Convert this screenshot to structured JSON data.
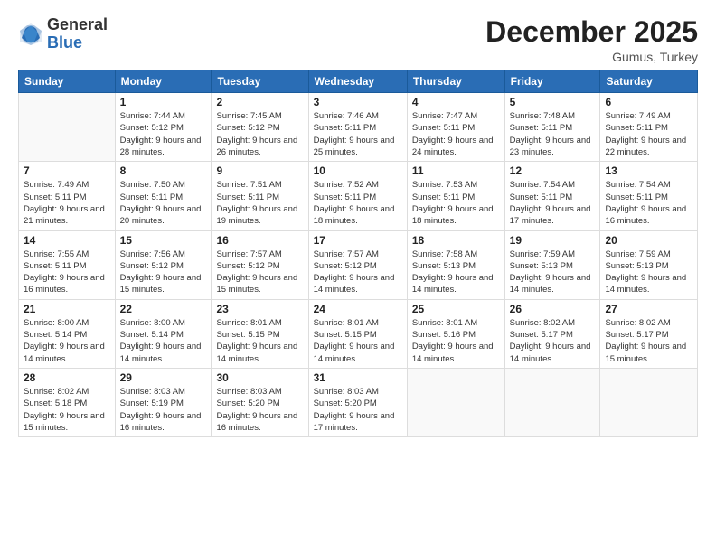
{
  "logo": {
    "general": "General",
    "blue": "Blue"
  },
  "header": {
    "month": "December 2025",
    "location": "Gumus, Turkey"
  },
  "days_of_week": [
    "Sunday",
    "Monday",
    "Tuesday",
    "Wednesday",
    "Thursday",
    "Friday",
    "Saturday"
  ],
  "weeks": [
    [
      {
        "day": "",
        "info": ""
      },
      {
        "day": "1",
        "info": "Sunrise: 7:44 AM\nSunset: 5:12 PM\nDaylight: 9 hours\nand 28 minutes."
      },
      {
        "day": "2",
        "info": "Sunrise: 7:45 AM\nSunset: 5:12 PM\nDaylight: 9 hours\nand 26 minutes."
      },
      {
        "day": "3",
        "info": "Sunrise: 7:46 AM\nSunset: 5:11 PM\nDaylight: 9 hours\nand 25 minutes."
      },
      {
        "day": "4",
        "info": "Sunrise: 7:47 AM\nSunset: 5:11 PM\nDaylight: 9 hours\nand 24 minutes."
      },
      {
        "day": "5",
        "info": "Sunrise: 7:48 AM\nSunset: 5:11 PM\nDaylight: 9 hours\nand 23 minutes."
      },
      {
        "day": "6",
        "info": "Sunrise: 7:49 AM\nSunset: 5:11 PM\nDaylight: 9 hours\nand 22 minutes."
      }
    ],
    [
      {
        "day": "7",
        "info": "Sunrise: 7:49 AM\nSunset: 5:11 PM\nDaylight: 9 hours\nand 21 minutes."
      },
      {
        "day": "8",
        "info": "Sunrise: 7:50 AM\nSunset: 5:11 PM\nDaylight: 9 hours\nand 20 minutes."
      },
      {
        "day": "9",
        "info": "Sunrise: 7:51 AM\nSunset: 5:11 PM\nDaylight: 9 hours\nand 19 minutes."
      },
      {
        "day": "10",
        "info": "Sunrise: 7:52 AM\nSunset: 5:11 PM\nDaylight: 9 hours\nand 18 minutes."
      },
      {
        "day": "11",
        "info": "Sunrise: 7:53 AM\nSunset: 5:11 PM\nDaylight: 9 hours\nand 18 minutes."
      },
      {
        "day": "12",
        "info": "Sunrise: 7:54 AM\nSunset: 5:11 PM\nDaylight: 9 hours\nand 17 minutes."
      },
      {
        "day": "13",
        "info": "Sunrise: 7:54 AM\nSunset: 5:11 PM\nDaylight: 9 hours\nand 16 minutes."
      }
    ],
    [
      {
        "day": "14",
        "info": "Sunrise: 7:55 AM\nSunset: 5:11 PM\nDaylight: 9 hours\nand 16 minutes."
      },
      {
        "day": "15",
        "info": "Sunrise: 7:56 AM\nSunset: 5:12 PM\nDaylight: 9 hours\nand 15 minutes."
      },
      {
        "day": "16",
        "info": "Sunrise: 7:57 AM\nSunset: 5:12 PM\nDaylight: 9 hours\nand 15 minutes."
      },
      {
        "day": "17",
        "info": "Sunrise: 7:57 AM\nSunset: 5:12 PM\nDaylight: 9 hours\nand 14 minutes."
      },
      {
        "day": "18",
        "info": "Sunrise: 7:58 AM\nSunset: 5:13 PM\nDaylight: 9 hours\nand 14 minutes."
      },
      {
        "day": "19",
        "info": "Sunrise: 7:59 AM\nSunset: 5:13 PM\nDaylight: 9 hours\nand 14 minutes."
      },
      {
        "day": "20",
        "info": "Sunrise: 7:59 AM\nSunset: 5:13 PM\nDaylight: 9 hours\nand 14 minutes."
      }
    ],
    [
      {
        "day": "21",
        "info": "Sunrise: 8:00 AM\nSunset: 5:14 PM\nDaylight: 9 hours\nand 14 minutes."
      },
      {
        "day": "22",
        "info": "Sunrise: 8:00 AM\nSunset: 5:14 PM\nDaylight: 9 hours\nand 14 minutes."
      },
      {
        "day": "23",
        "info": "Sunrise: 8:01 AM\nSunset: 5:15 PM\nDaylight: 9 hours\nand 14 minutes."
      },
      {
        "day": "24",
        "info": "Sunrise: 8:01 AM\nSunset: 5:15 PM\nDaylight: 9 hours\nand 14 minutes."
      },
      {
        "day": "25",
        "info": "Sunrise: 8:01 AM\nSunset: 5:16 PM\nDaylight: 9 hours\nand 14 minutes."
      },
      {
        "day": "26",
        "info": "Sunrise: 8:02 AM\nSunset: 5:17 PM\nDaylight: 9 hours\nand 14 minutes."
      },
      {
        "day": "27",
        "info": "Sunrise: 8:02 AM\nSunset: 5:17 PM\nDaylight: 9 hours\nand 15 minutes."
      }
    ],
    [
      {
        "day": "28",
        "info": "Sunrise: 8:02 AM\nSunset: 5:18 PM\nDaylight: 9 hours\nand 15 minutes."
      },
      {
        "day": "29",
        "info": "Sunrise: 8:03 AM\nSunset: 5:19 PM\nDaylight: 9 hours\nand 16 minutes."
      },
      {
        "day": "30",
        "info": "Sunrise: 8:03 AM\nSunset: 5:20 PM\nDaylight: 9 hours\nand 16 minutes."
      },
      {
        "day": "31",
        "info": "Sunrise: 8:03 AM\nSunset: 5:20 PM\nDaylight: 9 hours\nand 17 minutes."
      },
      {
        "day": "",
        "info": ""
      },
      {
        "day": "",
        "info": ""
      },
      {
        "day": "",
        "info": ""
      }
    ]
  ]
}
